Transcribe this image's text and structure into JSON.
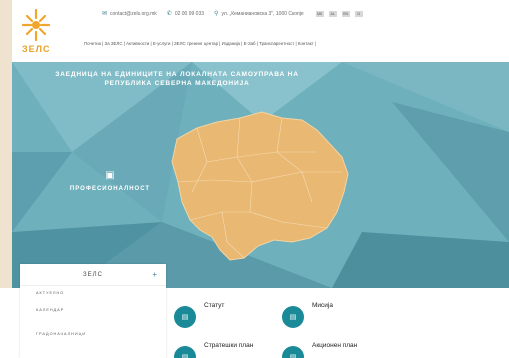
{
  "header": {
    "logo_text": "ЗЕЛС",
    "email": "contact@zels.org.mk",
    "phone": "02 00 99 033",
    "address": "ул. „Кеманиановска 3\", 1000 Скопје",
    "languages": [
      "МК",
      "AL",
      "EN",
      "Ω"
    ],
    "nav": "Почетна | За ЗЕЛС | Активности | Е-услуги | ЗЕЛС тренинг центар | Изданија | Е-Заб | Транспарентност | Контакт |"
  },
  "hero": {
    "title_line1": "ЗАЕДНИЦА НА ЕДИНИЦИТЕ НА ЛОКАЛНАТА САМОУПРАВА НА",
    "title_line2": "РЕПУБЛИКА СЕВЕРНА МАКЕДОНИЈА",
    "feature_label": "ПРОФЕСИОНАЛНОСТ",
    "map_color": "#e9b873",
    "bg_color": "#6fb0bd"
  },
  "sidebar": {
    "title": "ЗЕЛС",
    "items": [
      "АКТУЕЛНО",
      "КАЛЕНДАР",
      "ГРАДОНАЧАЛНИЦИ"
    ]
  },
  "links": [
    {
      "label": "Статут"
    },
    {
      "label": "Мисија"
    },
    {
      "label": "Стратешки план"
    },
    {
      "label": "Акционен план"
    }
  ],
  "accent": "#1a8a98"
}
